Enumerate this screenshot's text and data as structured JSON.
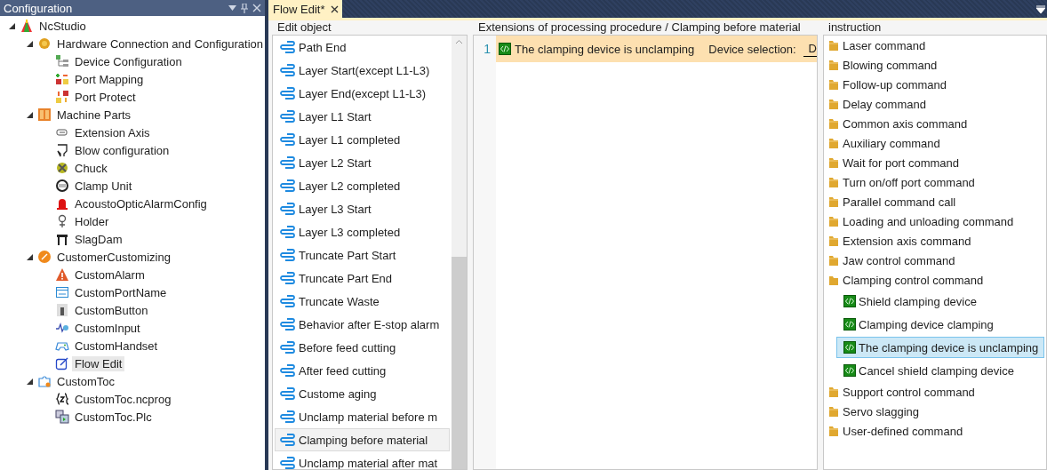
{
  "config_panel": {
    "title": "Configuration",
    "tree": [
      {
        "label": "NcStudio",
        "expanded": true,
        "selected": false,
        "children": [
          {
            "label": "Hardware Connection and Configuration",
            "expanded": true,
            "selected": false,
            "children": [
              {
                "label": "Device Configuration",
                "selected": false
              },
              {
                "label": "Port Mapping",
                "selected": false
              },
              {
                "label": "Port Protect",
                "selected": false
              }
            ]
          },
          {
            "label": "Machine Parts",
            "expanded": true,
            "selected": false,
            "children": [
              {
                "label": "Extension Axis",
                "selected": false
              },
              {
                "label": "Blow configuration",
                "selected": false
              },
              {
                "label": "Chuck",
                "selected": false
              },
              {
                "label": "Clamp Unit",
                "selected": false
              },
              {
                "label": "AcoustoOpticAlarmConfig",
                "selected": false
              },
              {
                "label": "Holder",
                "selected": false
              },
              {
                "label": "SlagDam",
                "selected": false
              }
            ]
          },
          {
            "label": "CustomerCustomizing",
            "expanded": true,
            "selected": false,
            "children": [
              {
                "label": "CustomAlarm",
                "selected": false
              },
              {
                "label": "CustomPortName",
                "selected": false
              },
              {
                "label": "CustomButton",
                "selected": false
              },
              {
                "label": "CustomInput",
                "selected": false
              },
              {
                "label": "CustomHandset",
                "selected": false
              },
              {
                "label": "Flow Edit",
                "selected": true
              }
            ]
          },
          {
            "label": "CustomToc",
            "expanded": true,
            "selected": false,
            "children": [
              {
                "label": "CustomToc.ncprog",
                "selected": false
              },
              {
                "label": "CustomToc.Plc",
                "selected": false
              }
            ]
          }
        ]
      }
    ]
  },
  "tabs": [
    {
      "label": "Flow Edit*",
      "selected": true
    }
  ],
  "edit_object": {
    "title": "Edit object",
    "items": [
      {
        "label": "Path End",
        "selected": false
      },
      {
        "label": "Layer Start(except L1-L3)",
        "selected": false
      },
      {
        "label": "Layer End(except L1-L3)",
        "selected": false
      },
      {
        "label": "Layer L1 Start",
        "selected": false
      },
      {
        "label": "Layer L1 completed",
        "selected": false
      },
      {
        "label": "Layer L2 Start",
        "selected": false
      },
      {
        "label": "Layer L2 completed",
        "selected": false
      },
      {
        "label": "Layer L3 Start",
        "selected": false
      },
      {
        "label": "Layer L3 completed",
        "selected": false
      },
      {
        "label": "Truncate Part Start",
        "selected": false
      },
      {
        "label": "Truncate Part End",
        "selected": false
      },
      {
        "label": "Truncate Waste",
        "selected": false
      },
      {
        "label": "Behavior after E-stop alarm",
        "selected": false
      },
      {
        "label": "Before feed cutting",
        "selected": false
      },
      {
        "label": "After feed cutting",
        "selected": false
      },
      {
        "label": "Custome aging",
        "selected": false
      },
      {
        "label": "Unclamp material before m",
        "selected": false
      },
      {
        "label": "Clamping before material",
        "selected": true
      },
      {
        "label": "Unclamp material after mat",
        "selected": false
      }
    ]
  },
  "editor": {
    "title": "Extensions of processing procedure / Clamping before material",
    "lines": [
      {
        "number": "1",
        "command": "The clamping device is unclamping",
        "field_label": "Device selection:",
        "field_value": "D",
        "selected": true
      }
    ]
  },
  "instruction": {
    "title": "instruction",
    "items": [
      {
        "label": "Laser command",
        "expanded": false
      },
      {
        "label": "Blowing command",
        "expanded": false
      },
      {
        "label": "Follow-up command",
        "expanded": false
      },
      {
        "label": "Delay command",
        "expanded": false
      },
      {
        "label": "Common axis command",
        "expanded": false
      },
      {
        "label": "Auxiliary command",
        "expanded": false
      },
      {
        "label": "Wait for port command",
        "expanded": false
      },
      {
        "label": "Turn on/off port command",
        "expanded": false
      },
      {
        "label": "Parallel command call",
        "expanded": false
      },
      {
        "label": "Loading and unloading command",
        "expanded": false
      },
      {
        "label": "Extension axis command",
        "expanded": false
      },
      {
        "label": "Jaw control command",
        "expanded": false
      },
      {
        "label": "Clamping control command",
        "expanded": true,
        "children": [
          {
            "label": "Shield clamping device",
            "selected": false
          },
          {
            "label": "Clamping device clamping",
            "selected": false
          },
          {
            "label": "The clamping device is unclamping",
            "selected": true
          },
          {
            "label": "Cancel shield clamping device",
            "selected": false
          }
        ]
      },
      {
        "label": "Support control command",
        "expanded": false
      },
      {
        "label": "Servo slagging",
        "expanded": false
      },
      {
        "label": "User-defined command",
        "expanded": false
      }
    ]
  }
}
